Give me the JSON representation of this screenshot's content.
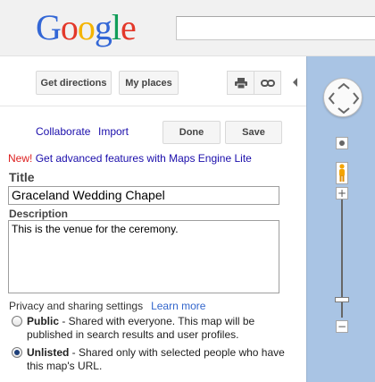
{
  "header": {
    "logo": {
      "letters": [
        {
          "ch": "G",
          "color": "#3367d6"
        },
        {
          "ch": "o",
          "color": "#e3382a"
        },
        {
          "ch": "o",
          "color": "#f4b400"
        },
        {
          "ch": "g",
          "color": "#3367d6"
        },
        {
          "ch": "l",
          "color": "#109d58"
        },
        {
          "ch": "e",
          "color": "#e3382a"
        }
      ]
    },
    "search": {
      "value": "",
      "placeholder": ""
    }
  },
  "toolbar": {
    "get_directions": "Get directions",
    "my_places": "My places",
    "print_icon": "printer-icon",
    "link_icon": "link-icon",
    "collapse_icon": "collapse-arrow-icon"
  },
  "editor": {
    "collaborate": "Collaborate",
    "import": "Import",
    "done": "Done",
    "save": "Save",
    "new_tag": "New!",
    "promo_link": "Get advanced features with Maps Engine Lite",
    "title_label": "Title",
    "title_value": "Graceland Wedding Chapel",
    "description_label": "Description",
    "description_value": "This is the venue for the ceremony.",
    "privacy_heading": "Privacy and sharing settings",
    "learn_more": "Learn more",
    "options": [
      {
        "name": "Public",
        "text": " - Shared with everyone. This map will be published in search results and user profiles.",
        "checked": false
      },
      {
        "name": "Unlisted",
        "text": " - Shared only with selected people who have this map's URL.",
        "checked": true
      }
    ]
  },
  "map": {
    "pan_icon": "pan-control-icon",
    "pegman_icon": "pegman-icon",
    "zoom_in": "+",
    "zoom_out": "−",
    "zoom_level_fraction": 0.15,
    "water_color": "#a9c4e4"
  }
}
